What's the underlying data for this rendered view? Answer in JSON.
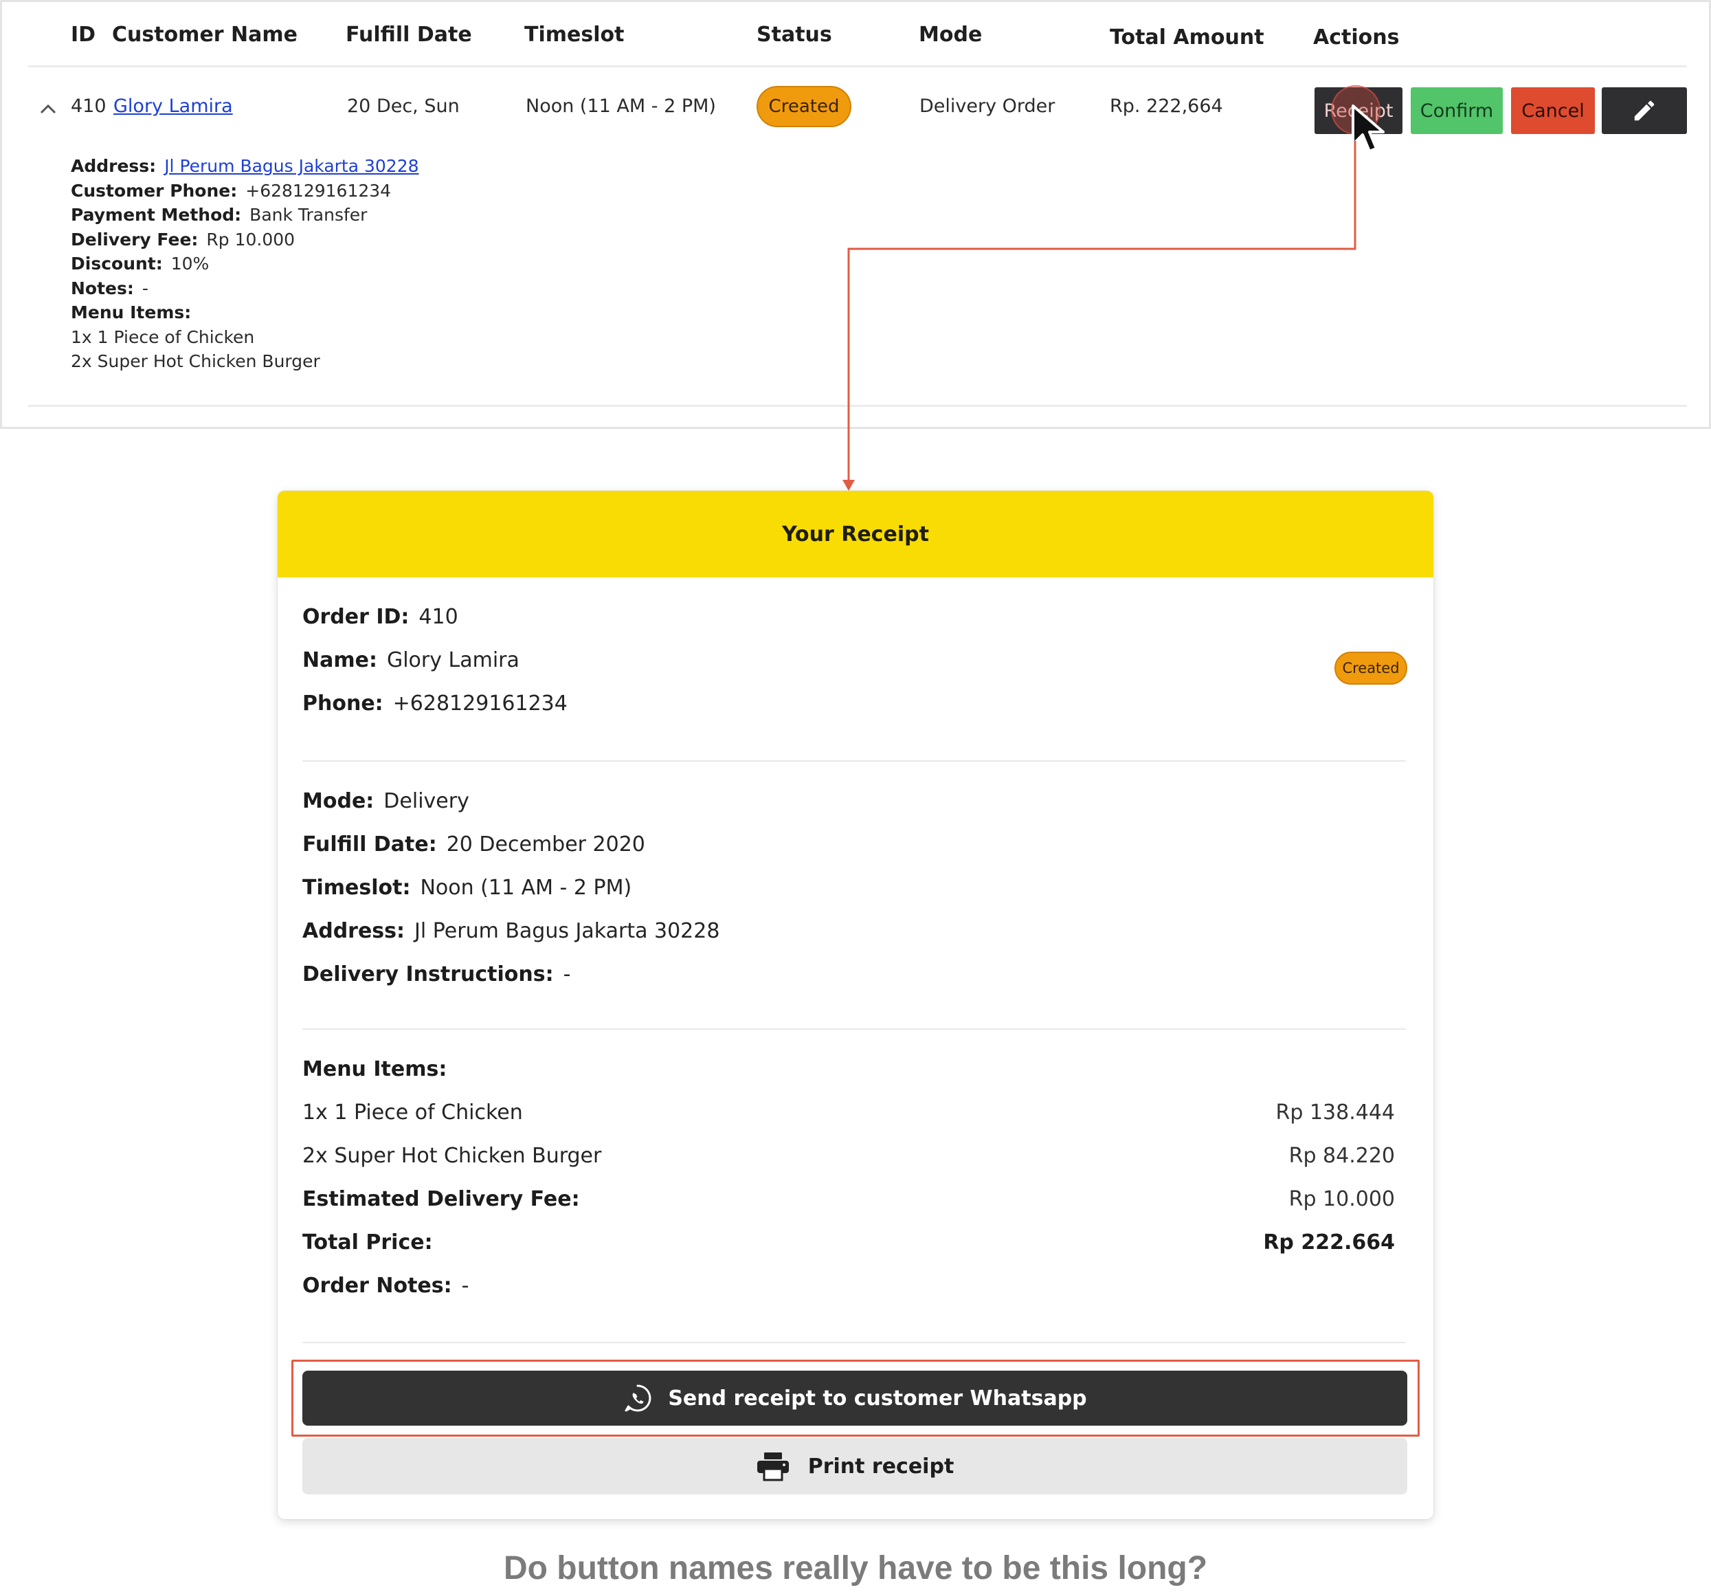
{
  "table": {
    "headers": {
      "id": "ID",
      "customer_name": "Customer Name",
      "fulfill_date": "Fulfill Date",
      "timeslot": "Timeslot",
      "status": "Status",
      "mode": "Mode",
      "total_amount": "Total Amount",
      "actions": "Actions"
    },
    "row": {
      "id": "410",
      "customer_name": "Glory Lamira",
      "fulfill_date": "20 Dec, Sun",
      "timeslot": "Noon (11 AM - 2 PM)",
      "status": "Created",
      "mode": "Delivery Order",
      "total_amount": "Rp. 222,664",
      "actions": {
        "receipt": "Receipt",
        "confirm": "Confirm",
        "cancel": "Cancel",
        "edit_icon": "pencil-icon"
      }
    },
    "details": {
      "address_label": "Address:",
      "address": "Jl Perum Bagus Jakarta 30228",
      "phone_label": "Customer Phone:",
      "phone": "+628129161234",
      "payment_label": "Payment Method:",
      "payment": "Bank Transfer",
      "delivery_fee_label": "Delivery Fee:",
      "delivery_fee": "Rp 10.000",
      "discount_label": "Discount:",
      "discount": "10%",
      "notes_label": "Notes:",
      "notes": "-",
      "menu_label": "Menu Items:",
      "items": [
        "1x 1 Piece of Chicken",
        "2x Super Hot Chicken Burger"
      ]
    }
  },
  "receipt": {
    "title": "Your Receipt",
    "order_id_label": "Order ID:",
    "order_id": "410",
    "name_label": "Name:",
    "name": "Glory Lamira",
    "phone_label": "Phone:",
    "phone": "+628129161234",
    "status": "Created",
    "mode_label": "Mode:",
    "mode": "Delivery",
    "fulfill_label": "Fulfill Date:",
    "fulfill": "20 December 2020",
    "timeslot_label": "Timeslot:",
    "timeslot": "Noon (11 AM - 2 PM)",
    "address_label": "Address:",
    "address": "Jl Perum Bagus Jakarta 30228",
    "instructions_label": "Delivery Instructions:",
    "instructions": "-",
    "menu_label": "Menu Items:",
    "items": [
      {
        "name": "1x 1 Piece of Chicken",
        "price": "Rp 138.444"
      },
      {
        "name": "2x Super Hot Chicken Burger",
        "price": "Rp 84.220"
      }
    ],
    "delivery_fee_label": "Estimated Delivery Fee:",
    "delivery_fee": "Rp 10.000",
    "total_label": "Total Price:",
    "total": "Rp 222.664",
    "notes_label": "Order Notes:",
    "notes": "-",
    "whatsapp_button": "Send receipt to customer Whatsapp",
    "print_button": "Print receipt"
  },
  "caption": "Do button names really have to be this long?",
  "colors": {
    "status_created": "#f09b0e",
    "confirm": "#52c46a",
    "cancel": "#de4b2f",
    "dark_button": "#2f2f31",
    "receipt_header": "#f8dc03",
    "annotation": "#e25c43",
    "caption": "#7b7b7b"
  },
  "icons": [
    "chevron-up-icon",
    "pencil-icon",
    "cursor-icon",
    "whatsapp-icon",
    "printer-icon"
  ]
}
